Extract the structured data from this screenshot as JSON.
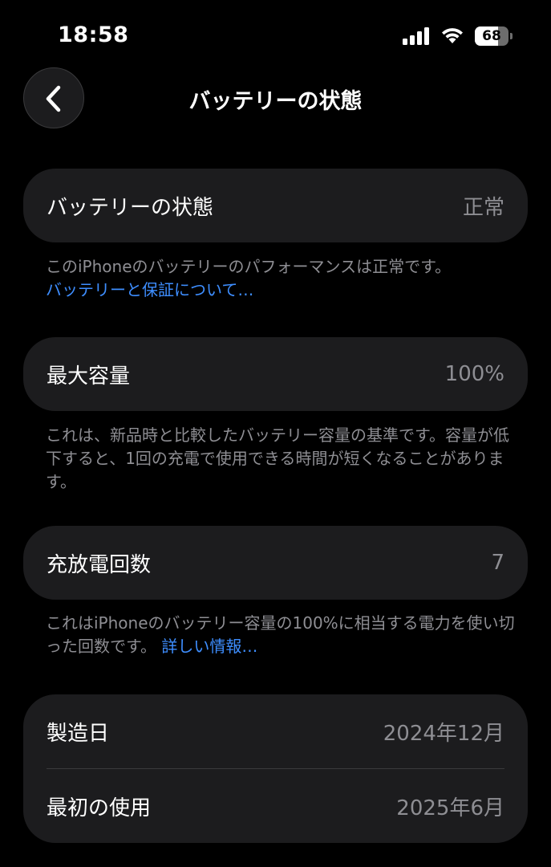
{
  "status_bar": {
    "time": "18:58",
    "battery_level": "68",
    "battery_fraction": 0.68,
    "signal_icon": "cellular-signal-icon",
    "wifi_icon": "wifi-icon"
  },
  "nav": {
    "back_icon": "chevron-left-icon",
    "title": "バッテリーの状態"
  },
  "health": {
    "label": "バッテリーの状態",
    "value": "正常",
    "note": "このiPhoneのバッテリーのパフォーマンスは正常です。",
    "link": "バッテリーと保証について…"
  },
  "capacity": {
    "label": "最大容量",
    "value": "100%",
    "note": "これは、新品時と比較したバッテリー容量の基準です。容量が低下すると、1回の充電で使用できる時間が短くなることがあります。"
  },
  "cycles": {
    "label": "充放電回数",
    "value": "7",
    "note": "これはiPhoneのバッテリー容量の100%に相当する電力を使い切った回数です。",
    "link": "詳しい情報…"
  },
  "dates": {
    "manufacture_label": "製造日",
    "manufacture_value": "2024年12月",
    "first_use_label": "最初の使用",
    "first_use_value": "2025年6月"
  },
  "colors": {
    "background": "#000000",
    "card": "#1c1c1e",
    "secondary_text": "#8e8e93",
    "link": "#3e8eff"
  }
}
